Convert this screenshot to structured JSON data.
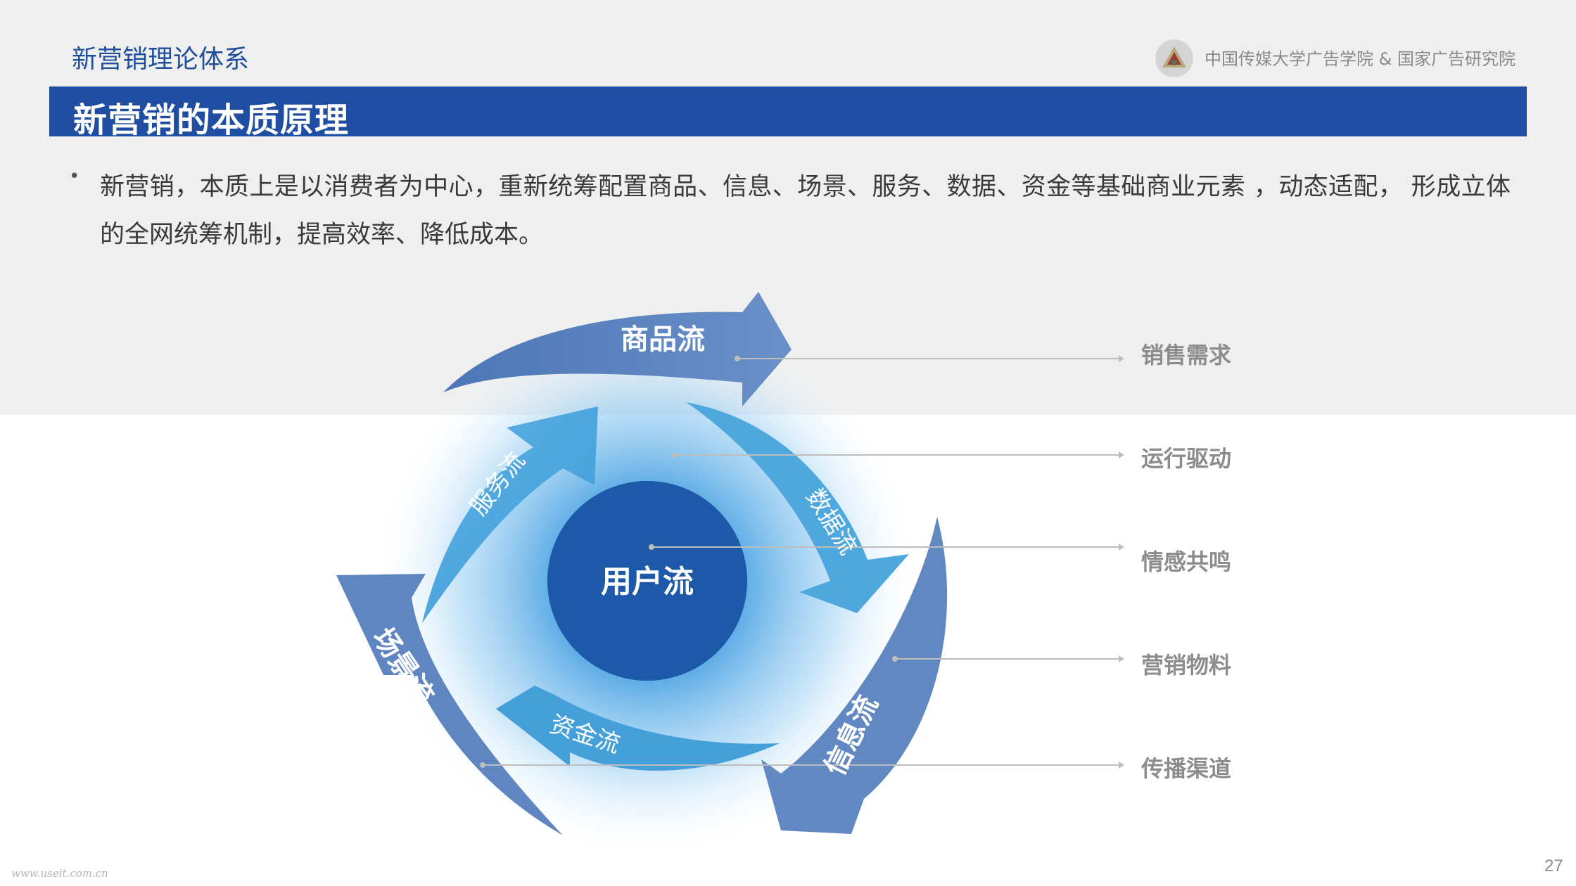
{
  "header": {
    "section_title": "新营销理论体系",
    "org_name": "中国传媒大学广告学院 & 国家广告研究院"
  },
  "title": "新营销的本质原理",
  "body": {
    "bullet": "•",
    "text": "新营销，本质上是以消费者为中心，重新统筹配置商品、信息、场景、服务、数据、资金等基础商业元素 ，动态适配， 形成立体的全网统筹机制，提高效率、降低成本。"
  },
  "diagram": {
    "center": "用户流",
    "outer_arrows": [
      "商品流",
      "信息流",
      "场景流"
    ],
    "inner_arrows": [
      "服务流",
      "数据流",
      "资金流"
    ],
    "callouts": [
      "销售需求",
      "运行驱动",
      "情感共鸣",
      "营销物料",
      "传播渠道"
    ],
    "colors": {
      "outer_arrow": "#5e86c0",
      "inner_arrow": "#4ea6da",
      "center": "#1e58a8",
      "title_bar": "#1e4da2",
      "callout_text": "#8c8c8c",
      "leader_line": "#bdbdbd"
    }
  },
  "footer": {
    "url": "www.useit.com.cn",
    "page": "27"
  }
}
